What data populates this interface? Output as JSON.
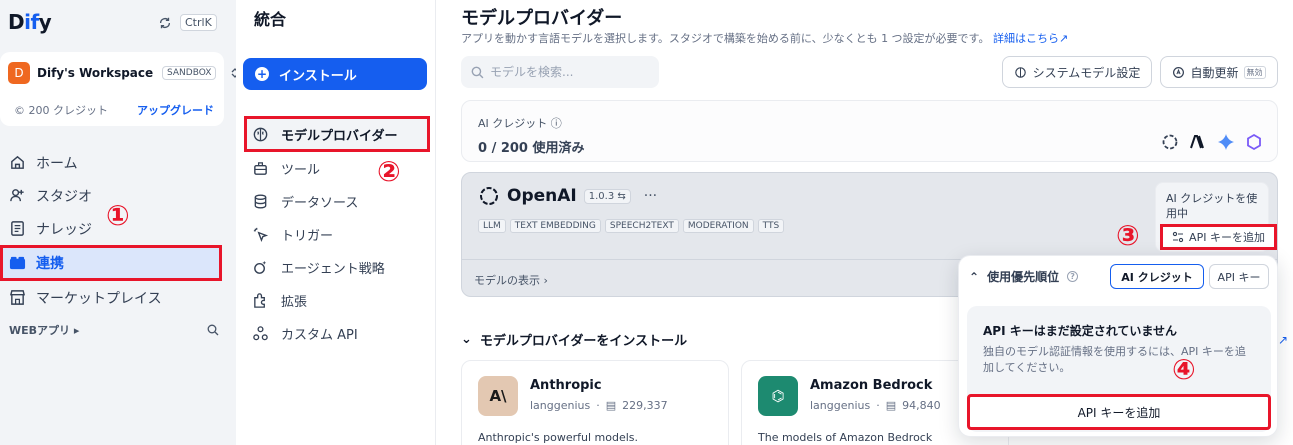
{
  "sidebar": {
    "logo_pre": "D",
    "logo_mid": "if",
    "logo_post": "y",
    "shortcut": "CtrlK",
    "workspace": {
      "avatar": "D",
      "name": "Dify's Workspace",
      "plan": "SANDBOX",
      "credits": "200 クレジット",
      "upgrade": "アップグレード"
    },
    "nav": [
      {
        "label": "ホーム",
        "icon": "home-icon"
      },
      {
        "label": "スタジオ",
        "icon": "studio-icon"
      },
      {
        "label": "ナレッジ",
        "icon": "knowledge-icon"
      },
      {
        "label": "連携",
        "icon": "integration-icon",
        "active": true
      },
      {
        "label": "マーケットプレイス",
        "icon": "marketplace-icon"
      }
    ],
    "web_app": "WEBアプリ"
  },
  "middle": {
    "title": "統合",
    "install": "インストール",
    "items": [
      {
        "label": "モデルプロバイダー",
        "active": true
      },
      {
        "label": "ツール"
      },
      {
        "label": "データソース"
      },
      {
        "label": "トリガー"
      },
      {
        "label": "エージェント戦略"
      },
      {
        "label": "拡張"
      },
      {
        "label": "カスタム API"
      }
    ]
  },
  "main": {
    "title": "モデルプロバイダー",
    "desc": "アプリを動かす言語モデルを選択します。スタジオで構築を始める前に、少なくとも 1 つ設定が必要です。",
    "details_link": "詳細はこちら",
    "search_placeholder": "モデルを検索...",
    "system_model": "システムモデル設定",
    "auto_update": "自動更新",
    "auto_update_state": "無効",
    "ai_credit_label": "AI クレジット",
    "ai_credit_value": "0 / 200 使用済み",
    "openai": {
      "name": "OpenAI",
      "version": "1.0.3",
      "tags": [
        "LLM",
        "TEXT EMBEDDING",
        "SPEECH2TEXT",
        "MODERATION",
        "TTS"
      ],
      "show_models": "モデルの表示",
      "credit_use": "AI クレジットを使用中",
      "api_add": "API キーを追加"
    },
    "install_section": "モデルプロバイダーをインストール",
    "providers": [
      {
        "name": "Anthropic",
        "author": "langgenius",
        "installs": "229,337",
        "desc": "Anthropic's powerful models."
      },
      {
        "name": "Amazon Bedrock",
        "author": "langgenius",
        "installs": "94,840",
        "desc": "The models of Amazon Bedrock"
      }
    ]
  },
  "popover": {
    "priority": "使用優先順位",
    "tab_credit": "AI クレジット",
    "tab_api": "API キー",
    "warn": "API キーはまだ設定されていません",
    "desc": "独自のモデル認証情報を使用するには、API キーを追加してください。",
    "button": "API キーを追加"
  },
  "annotations": [
    "①",
    "②",
    "③",
    "④"
  ],
  "colors": {
    "accent": "#155eef",
    "highlight": "#e8152a"
  }
}
